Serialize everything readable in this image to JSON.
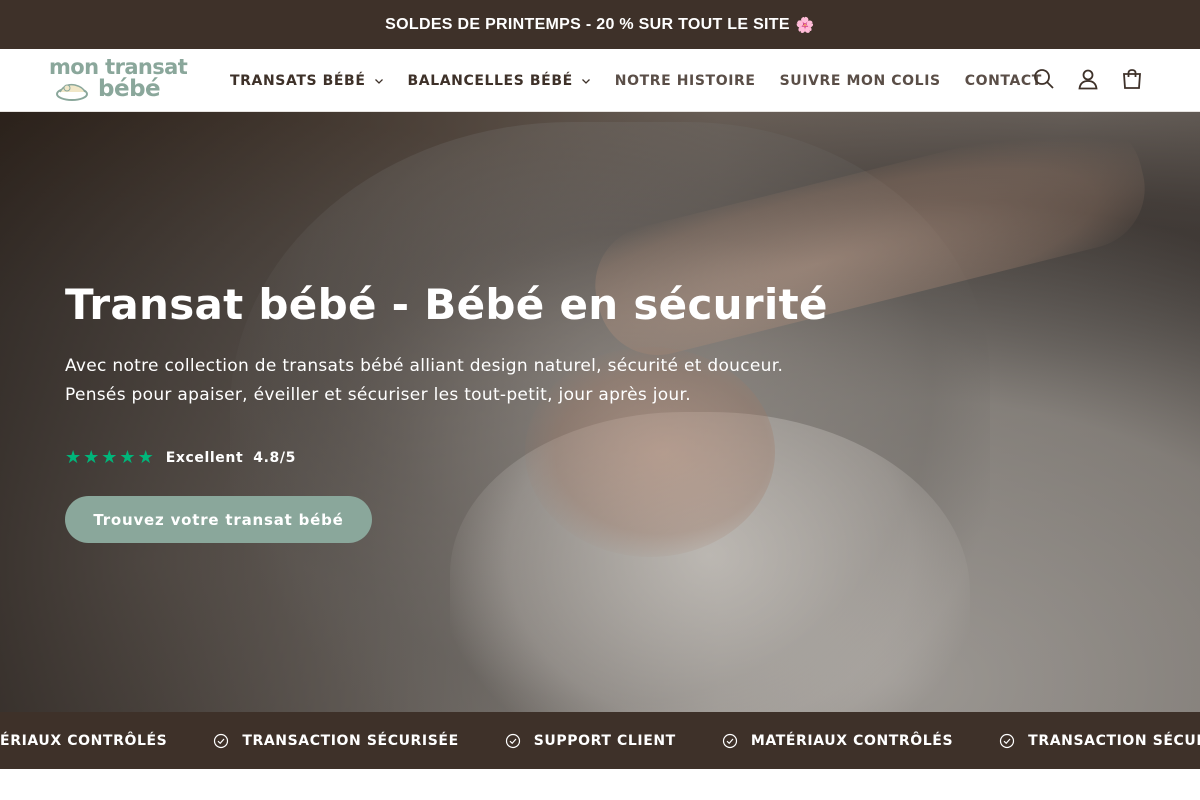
{
  "announcement": {
    "text": "SOLDES DE PRINTEMPS - 20 % SUR TOUT LE SITE",
    "emoji": "🌸"
  },
  "header": {
    "logo": {
      "line1": "mon transat",
      "line2": "bébé"
    },
    "nav": [
      {
        "label": "TRANSATS BÉBÉ",
        "has_dropdown": true
      },
      {
        "label": "BALANCELLES BÉBÉ",
        "has_dropdown": true
      },
      {
        "label": "NOTRE HISTOIRE",
        "has_dropdown": false
      },
      {
        "label": "SUIVRE MON COLIS",
        "has_dropdown": false
      },
      {
        "label": "CONTACT",
        "has_dropdown": false
      }
    ],
    "icons": [
      "search-icon",
      "account-icon",
      "cart-icon"
    ]
  },
  "hero": {
    "title": "Transat bébé - Bébé en sécurité",
    "text": "Avec notre collection de transats bébé alliant design naturel, sécurité et douceur. Pensés pour apaiser, éveiller et sécuriser les tout-petit, jour après jour.",
    "rating": {
      "stars": 5,
      "label": "Excellent",
      "score": "4.8/5"
    },
    "cta_label": "Trouvez votre transat bébé"
  },
  "trust_bar": {
    "items": [
      "MATÉRIAUX CONTRÔLÉS",
      "TRANSACTION SÉCURISÉE",
      "SUPPORT CLIENT",
      "MATÉRIAUX CONTRÔLÉS",
      "TRANSACTION SÉCURISÉE"
    ]
  },
  "colors": {
    "dark_brown": "#3e3129",
    "sage": "#8aa79b",
    "trustpilot_green": "#00b67a",
    "white": "#ffffff"
  }
}
